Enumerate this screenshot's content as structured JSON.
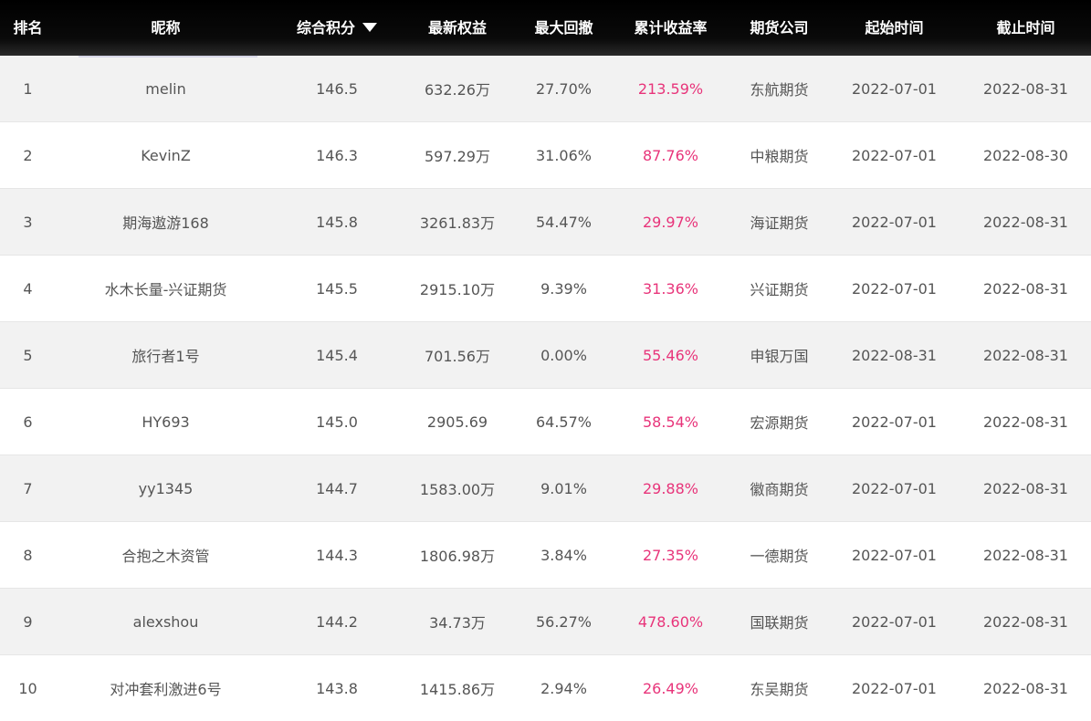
{
  "header": {
    "rank": "排名",
    "name": "昵称",
    "score": "综合积分",
    "equity": "最新权益",
    "max_drawdown": "最大回撤",
    "cum_return": "累计收益率",
    "company": "期货公司",
    "start": "起始时间",
    "end": "截止时间"
  },
  "colors": {
    "header_bg": "#000000",
    "header_text": "#ffffff",
    "row_odd": "#f2f2f2",
    "row_even": "#ffffff",
    "return_text": "#e8347a",
    "body_text": "#555555"
  },
  "rows": [
    {
      "rank": "1",
      "name": "melin",
      "score": "146.5",
      "equity": "632.26万",
      "max_drawdown": "27.70%",
      "cum_return": "213.59%",
      "company": "东航期货",
      "start": "2022-07-01",
      "end": "2022-08-31"
    },
    {
      "rank": "2",
      "name": "KevinZ",
      "score": "146.3",
      "equity": "597.29万",
      "max_drawdown": "31.06%",
      "cum_return": "87.76%",
      "company": "中粮期货",
      "start": "2022-07-01",
      "end": "2022-08-30"
    },
    {
      "rank": "3",
      "name": "期海遨游168",
      "score": "145.8",
      "equity": "3261.83万",
      "max_drawdown": "54.47%",
      "cum_return": "29.97%",
      "company": "海证期货",
      "start": "2022-07-01",
      "end": "2022-08-31"
    },
    {
      "rank": "4",
      "name": "水木长量-兴证期货",
      "score": "145.5",
      "equity": "2915.10万",
      "max_drawdown": "9.39%",
      "cum_return": "31.36%",
      "company": "兴证期货",
      "start": "2022-07-01",
      "end": "2022-08-31"
    },
    {
      "rank": "5",
      "name": "旅行者1号",
      "score": "145.4",
      "equity": "701.56万",
      "max_drawdown": "0.00%",
      "cum_return": "55.46%",
      "company": "申银万国",
      "start": "2022-08-31",
      "end": "2022-08-31"
    },
    {
      "rank": "6",
      "name": "HY693",
      "score": "145.0",
      "equity": "2905.69",
      "max_drawdown": "64.57%",
      "cum_return": "58.54%",
      "company": "宏源期货",
      "start": "2022-07-01",
      "end": "2022-08-31"
    },
    {
      "rank": "7",
      "name": "yy1345",
      "score": "144.7",
      "equity": "1583.00万",
      "max_drawdown": "9.01%",
      "cum_return": "29.88%",
      "company": "徽商期货",
      "start": "2022-07-01",
      "end": "2022-08-31"
    },
    {
      "rank": "8",
      "name": "合抱之木资管",
      "score": "144.3",
      "equity": "1806.98万",
      "max_drawdown": "3.84%",
      "cum_return": "27.35%",
      "company": "一德期货",
      "start": "2022-07-01",
      "end": "2022-08-31"
    },
    {
      "rank": "9",
      "name": "alexshou",
      "score": "144.2",
      "equity": "34.73万",
      "max_drawdown": "56.27%",
      "cum_return": "478.60%",
      "company": "国联期货",
      "start": "2022-07-01",
      "end": "2022-08-31"
    },
    {
      "rank": "10",
      "name": "对冲套利激进6号",
      "score": "143.8",
      "equity": "1415.86万",
      "max_drawdown": "2.94%",
      "cum_return": "26.49%",
      "company": "东吴期货",
      "start": "2022-07-01",
      "end": "2022-08-31"
    }
  ]
}
